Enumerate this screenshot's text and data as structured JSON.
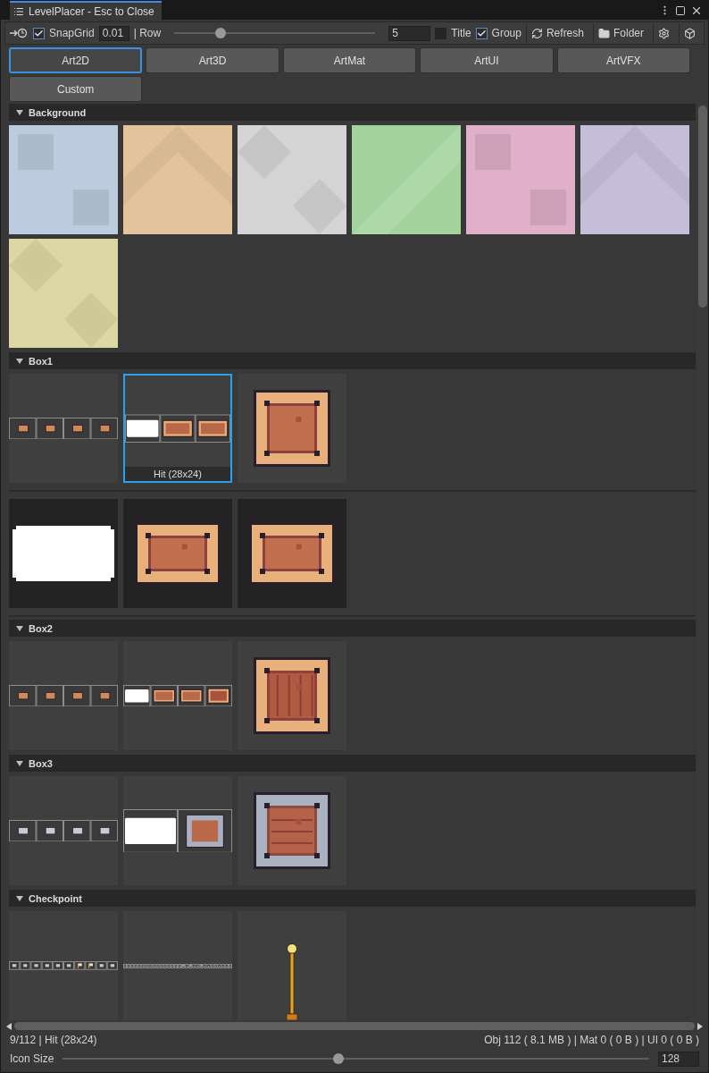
{
  "window": {
    "title": "LevelPlacer - Esc to Close"
  },
  "toolbar": {
    "snap_grid": {
      "label": "SnapGrid",
      "checked": true,
      "value": "0.01"
    },
    "row": {
      "label": "| Row",
      "level": 0.23,
      "value": "5"
    },
    "toggles": [
      {
        "label": "Title",
        "checked": false
      },
      {
        "label": "Group",
        "checked": true
      }
    ],
    "buttons": [
      {
        "kind": "refresh",
        "label": "Refresh"
      },
      {
        "kind": "folder",
        "label": "Folder"
      },
      {
        "kind": "settings"
      },
      {
        "kind": "cube"
      }
    ]
  },
  "categories": [
    {
      "label": "Art2D",
      "selected": true
    },
    {
      "label": "Art3D",
      "selected": false
    },
    {
      "label": "ArtMat",
      "selected": false
    },
    {
      "label": "ArtUI",
      "selected": false
    },
    {
      "label": "ArtVFX",
      "selected": false
    },
    {
      "label": "Custom",
      "selected": false
    }
  ],
  "sections": [
    {
      "name": "Background",
      "expanded": true,
      "rows": [
        {
          "tiles": [
            {
              "kind": "swatch",
              "color": "#bccbdd",
              "selected": false
            },
            {
              "kind": "swatch",
              "color": "#e3c39c",
              "selected": false
            },
            {
              "kind": "swatch",
              "color": "#d4d4d4",
              "selected": false
            },
            {
              "kind": "swatch",
              "color": "#a2d39c",
              "selected": false
            },
            {
              "kind": "swatch",
              "color": "#e0afc9",
              "selected": false
            },
            {
              "kind": "swatch",
              "color": "#c5bedb",
              "selected": false
            },
            {
              "kind": "swatch",
              "color": "#ddd7a3",
              "selected": false
            }
          ]
        }
      ]
    },
    {
      "name": "Box1",
      "expanded": true,
      "rows": [
        {
          "tiles": [
            {
              "kind": "sheet",
              "frames": [
                {
                  "kind": "corner"
                },
                {
                  "kind": "corner"
                },
                {
                  "kind": "corner"
                },
                {
                  "kind": "corner"
                }
              ],
              "selected": false
            },
            {
              "kind": "sheet",
              "frames": [
                {
                  "kind": "block"
                },
                {
                  "kind": "crate"
                },
                {
                  "kind": "crate"
                }
              ],
              "selected": true,
              "caption": "Hit (28x24)"
            },
            {
              "kind": "crate",
              "selected": false
            }
          ]
        },
        {
          "tiles": [
            {
              "kind": "block",
              "dark": true,
              "selected": false
            },
            {
              "kind": "wide-crate",
              "dark": true,
              "selected": false
            },
            {
              "kind": "wide-crate",
              "dark": true,
              "selected": false
            }
          ]
        }
      ]
    },
    {
      "name": "Box2",
      "expanded": true,
      "rows": [
        {
          "tiles": [
            {
              "kind": "sheet",
              "frames": [
                {
                  "kind": "corner"
                },
                {
                  "kind": "corner"
                },
                {
                  "kind": "corner"
                },
                {
                  "kind": "corner"
                }
              ],
              "selected": false
            },
            {
              "kind": "sheet",
              "frames": [
                {
                  "kind": "block"
                },
                {
                  "kind": "crate"
                },
                {
                  "kind": "crate"
                },
                {
                  "kind": "plank"
                }
              ],
              "selected": false
            },
            {
              "kind": "plank-crate",
              "selected": false
            }
          ]
        }
      ]
    },
    {
      "name": "Box3",
      "expanded": true,
      "rows": [
        {
          "tiles": [
            {
              "kind": "sheet",
              "frames": [
                {
                  "kind": "metal-corner"
                },
                {
                  "kind": "metal-corner"
                },
                {
                  "kind": "metal-corner"
                },
                {
                  "kind": "metal-corner"
                }
              ],
              "selected": false
            },
            {
              "kind": "sheet",
              "frames": [
                {
                  "kind": "block"
                },
                {
                  "kind": "metal"
                }
              ],
              "selected": false
            },
            {
              "kind": "metal-crate",
              "selected": false
            }
          ]
        }
      ]
    },
    {
      "name": "Checkpoint",
      "expanded": true,
      "rows": [
        {
          "tiles": [
            {
              "kind": "sheet",
              "frames": [
                {
                  "kind": "flag"
                },
                {
                  "kind": "flag"
                },
                {
                  "kind": "flag"
                },
                {
                  "kind": "flag"
                },
                {
                  "kind": "flag"
                },
                {
                  "kind": "flag"
                },
                {
                  "kind": "gold-flag"
                },
                {
                  "kind": "gold-flag"
                },
                {
                  "kind": "flag"
                },
                {
                  "kind": "flag"
                }
              ],
              "selected": false
            },
            {
              "kind": "sheet",
              "frames": [
                {
                  "kind": "tick"
                },
                {
                  "kind": "tick"
                },
                {
                  "kind": "tick"
                },
                {
                  "kind": "tick"
                },
                {
                  "kind": "tick"
                },
                {
                  "kind": "tick"
                },
                {
                  "kind": "tick"
                },
                {
                  "kind": "tick"
                },
                {
                  "kind": "tick"
                },
                {
                  "kind": "tick"
                },
                {
                  "kind": "tick"
                },
                {
                  "kind": "tick"
                },
                {
                  "kind": "tick"
                },
                {
                  "kind": "tick"
                },
                {
                  "kind": "tick"
                },
                {
                  "kind": "tick"
                },
                {
                  "kind": "gold-flag"
                },
                {
                  "kind": "flag"
                },
                {
                  "kind": "gold-flag"
                },
                {
                  "kind": "flag"
                },
                {
                  "kind": "flag"
                },
                {
                  "kind": "gold-flag"
                },
                {
                  "kind": "flag"
                },
                {
                  "kind": "flag"
                },
                {
                  "kind": "tick"
                },
                {
                  "kind": "tick"
                },
                {
                  "kind": "flag"
                },
                {
                  "kind": "flag"
                },
                {
                  "kind": "flag"
                },
                {
                  "kind": "tick"
                }
              ],
              "selected": false
            },
            {
              "kind": "pole",
              "selected": false
            }
          ]
        }
      ]
    }
  ],
  "status": {
    "selection": "9/112 | Hit (28x24)",
    "stats": "Obj 112 ( 8.1 MB ) | Mat 0 ( 0 B ) | UI 0 ( 0 B )"
  },
  "icon_size": {
    "label": "Icon Size",
    "level": 0.47,
    "value": "128"
  }
}
